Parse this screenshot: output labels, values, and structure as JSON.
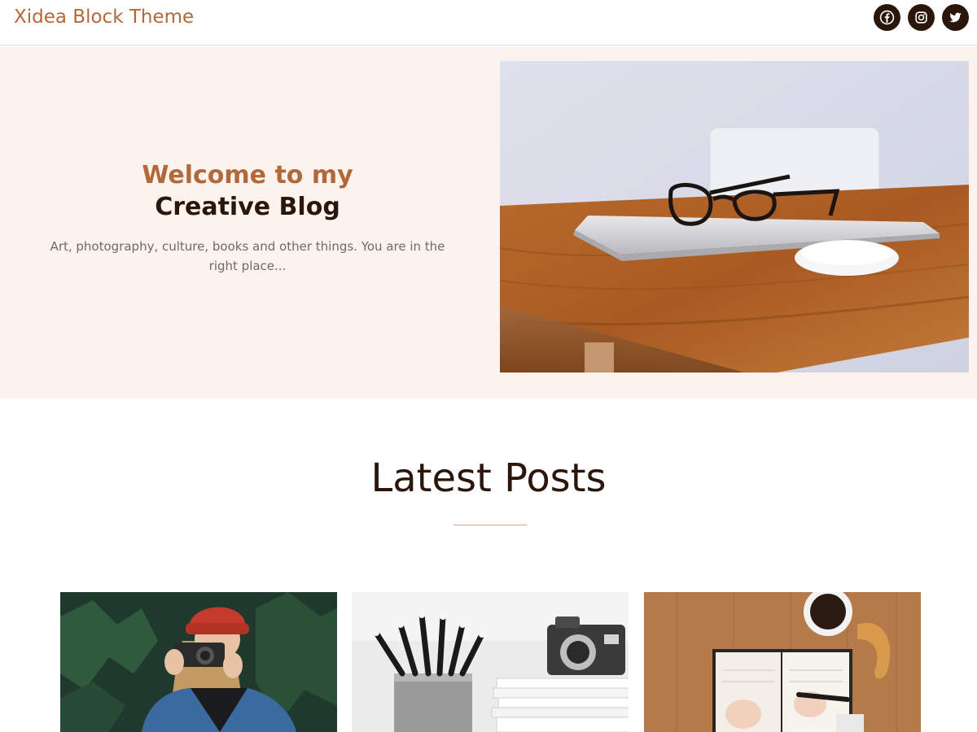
{
  "header": {
    "site_title": "Xidea Block Theme",
    "social_icons": [
      "facebook-icon",
      "instagram-icon",
      "twitter-icon"
    ]
  },
  "hero": {
    "heading_line1": "Welcome to my",
    "heading_line2": "Creative Blog",
    "description": "Art, photography, culture, books and other things. You are in the right place...",
    "image": "desk-laptop-glasses-photo"
  },
  "latest_posts": {
    "heading": "Latest Posts",
    "posts": [
      {
        "image": "woman-with-camera-photo"
      },
      {
        "image": "pencils-and-camera-photo"
      },
      {
        "image": "notebook-writing-coffee-photo"
      }
    ]
  },
  "colors": {
    "accent": "#b3683a",
    "dark": "#2b160c",
    "hero_bg": "#fcf3ef"
  }
}
